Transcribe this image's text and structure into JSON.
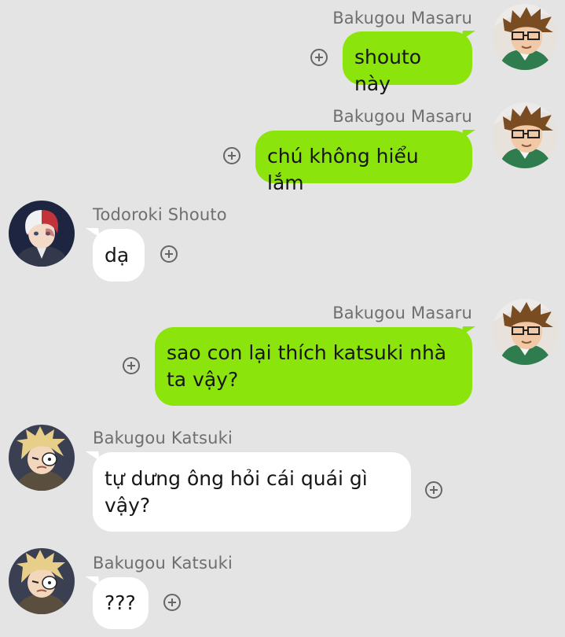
{
  "messages": [
    {
      "sender": "Bakugou Masaru",
      "text": "shouto này",
      "direction": "outgoing",
      "avatar_icon": "masaru-avatar-icon"
    },
    {
      "sender": "Bakugou Masaru",
      "text": "chú không hiểu lắm",
      "direction": "outgoing",
      "avatar_icon": "masaru-avatar-icon"
    },
    {
      "sender": "Todoroki Shouto",
      "text": "dạ",
      "direction": "incoming",
      "avatar_icon": "shouto-avatar-icon"
    },
    {
      "sender": "Bakugou Masaru",
      "text_lines": [
        "sao con lại thích katsuki nhà",
        "ta vậy?"
      ],
      "direction": "outgoing",
      "avatar_icon": "masaru-avatar-icon"
    },
    {
      "sender": "Bakugou Katsuki",
      "text_lines": [
        "tự dưng ông hỏi cái quái gì",
        "vậy?"
      ],
      "direction": "incoming",
      "avatar_icon": "katsuki-avatar-icon"
    },
    {
      "sender": "Bakugou Katsuki",
      "text": "???",
      "direction": "incoming",
      "avatar_icon": "katsuki-avatar-icon"
    }
  ],
  "colors": {
    "background": "#e4e4e4",
    "outgoing_bubble": "#8be50c",
    "incoming_bubble": "#ffffff",
    "sender_text": "#6f6f6f"
  },
  "icons": {
    "reaction": "plus-circle-icon"
  }
}
